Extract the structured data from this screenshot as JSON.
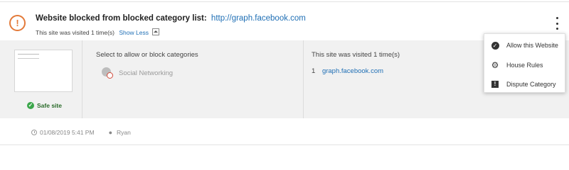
{
  "header": {
    "title": "Website blocked from blocked category list:",
    "url": "http://graph.facebook.com",
    "visits_text": "This site was visited 1 time(s)",
    "show_less": "Show Less"
  },
  "preview": {
    "safe_label": "Safe site"
  },
  "categories": {
    "heading": "Select to allow or block categories",
    "items": [
      {
        "label": "Social Networking"
      }
    ]
  },
  "visits": {
    "heading": "This site was visited 1 time(s)",
    "rows": [
      {
        "index": "1",
        "url": "graph.facebook.com"
      }
    ]
  },
  "footer": {
    "timestamp": "01/08/2019 5:41 PM",
    "user": "Ryan"
  },
  "menu": {
    "items": [
      {
        "label": "Allow this Website",
        "icon": "check-circle-icon"
      },
      {
        "label": "House Rules",
        "icon": "gear-icon"
      },
      {
        "label": "Dispute Category",
        "icon": "flag-icon"
      }
    ]
  },
  "colors": {
    "alert": "#e37a3a",
    "link": "#1f6fb5",
    "safe": "#3aa64a",
    "panel": "#f1f1f1"
  }
}
